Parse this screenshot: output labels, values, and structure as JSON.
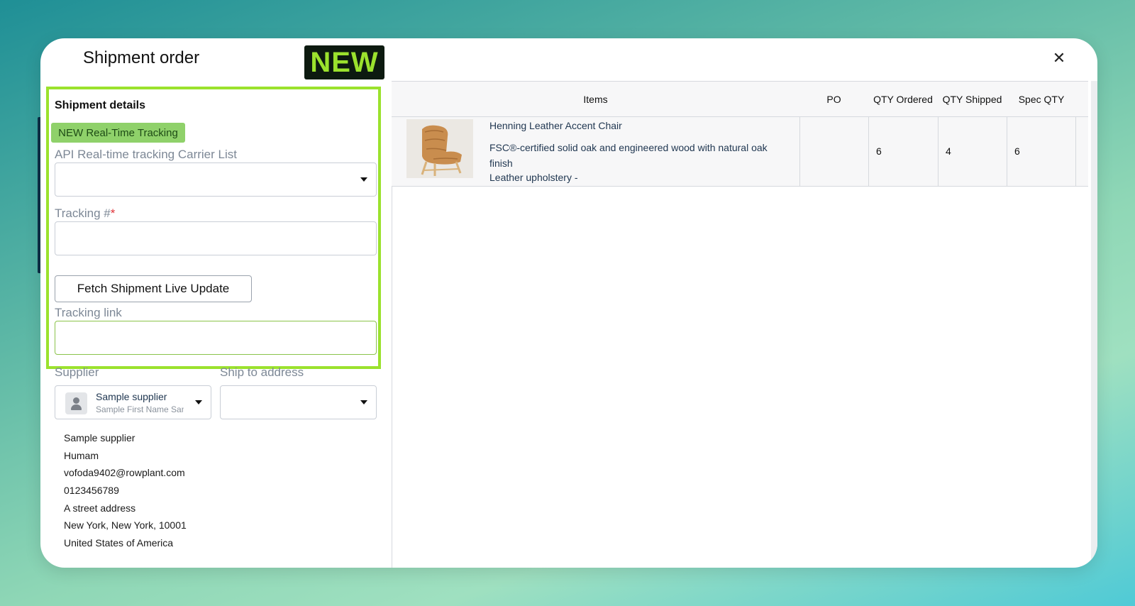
{
  "modal": {
    "title": "Shipment order",
    "badge": "NEW",
    "close_icon": "close-icon"
  },
  "shipment": {
    "section_title": "Shipment details",
    "tracking_badge": "NEW Real-Time Tracking",
    "carrier_label": "API Real-time tracking Carrier List",
    "carrier_value": "",
    "tracking_label": "Tracking #",
    "tracking_required": "*",
    "tracking_value": "",
    "fetch_button": "Fetch Shipment Live Update",
    "link_label": "Tracking link",
    "link_value": ""
  },
  "supplier": {
    "label": "Supplier",
    "name": "Sample supplier",
    "subtitle": "Sample First Name Sample Last Name",
    "ship_label": "Ship to address",
    "ship_value": ""
  },
  "address": {
    "lines": [
      "Sample supplier",
      "Humam",
      "vofoda9402@rowplant.com",
      "0123456789",
      "A street address",
      "New York, New York, 10001",
      "United States of America"
    ]
  },
  "table": {
    "headers": [
      "Items",
      "PO",
      "QTY Ordered",
      "QTY Shipped",
      "Spec QTY"
    ],
    "rows": [
      {
        "name": "Henning Leather Accent Chair",
        "description": "FSC®-certified solid oak and engineered wood with natural oak finish",
        "material": "Leather upholstery -",
        "po": "",
        "qty_ordered": "6",
        "qty_shipped": "4",
        "spec_qty": "6"
      }
    ]
  },
  "colors": {
    "highlight": "#9be22d",
    "badge_bg": "#0d1a10",
    "tracking_badge_bg": "#8fd16a"
  }
}
